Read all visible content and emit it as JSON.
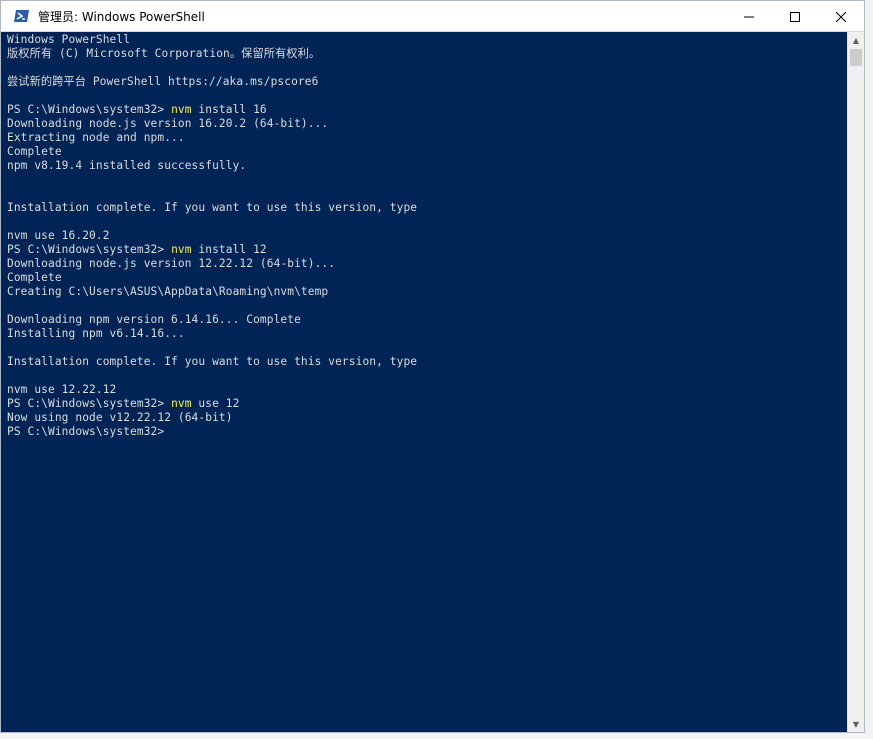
{
  "window": {
    "title": "管理员: Windows PowerShell",
    "icon": "powershell-icon"
  },
  "controls": {
    "minimize_icon": "minimize-icon",
    "maximize_icon": "maximize-icon",
    "close_icon": "close-icon"
  },
  "console": {
    "colors": {
      "background": "#012456",
      "text": "#dcdcdc",
      "command": "#f3f04a"
    },
    "lines": [
      {
        "prefix": "Windows PowerShell",
        "cmd": "",
        "rest": ""
      },
      {
        "prefix": "版权所有 (C) Microsoft Corporation。保留所有权利。",
        "cmd": "",
        "rest": ""
      },
      {
        "prefix": "",
        "cmd": "",
        "rest": ""
      },
      {
        "prefix": "尝试新的跨平台 PowerShell https://aka.ms/pscore6",
        "cmd": "",
        "rest": ""
      },
      {
        "prefix": "",
        "cmd": "",
        "rest": ""
      },
      {
        "prefix": "PS C:\\Windows\\system32> ",
        "cmd": "nvm",
        "rest": " install 16"
      },
      {
        "prefix": "Downloading node.js version 16.20.2 (64-bit)...",
        "cmd": "",
        "rest": ""
      },
      {
        "prefix": "Extracting node and npm...",
        "cmd": "",
        "rest": ""
      },
      {
        "prefix": "Complete",
        "cmd": "",
        "rest": ""
      },
      {
        "prefix": "npm v8.19.4 installed successfully.",
        "cmd": "",
        "rest": ""
      },
      {
        "prefix": "",
        "cmd": "",
        "rest": ""
      },
      {
        "prefix": "",
        "cmd": "",
        "rest": ""
      },
      {
        "prefix": "Installation complete. If you want to use this version, type",
        "cmd": "",
        "rest": ""
      },
      {
        "prefix": "",
        "cmd": "",
        "rest": ""
      },
      {
        "prefix": "nvm use 16.20.2",
        "cmd": "",
        "rest": ""
      },
      {
        "prefix": "PS C:\\Windows\\system32> ",
        "cmd": "nvm",
        "rest": " install 12"
      },
      {
        "prefix": "Downloading node.js version 12.22.12 (64-bit)...",
        "cmd": "",
        "rest": ""
      },
      {
        "prefix": "Complete",
        "cmd": "",
        "rest": ""
      },
      {
        "prefix": "Creating C:\\Users\\ASUS\\AppData\\Roaming\\nvm\\temp",
        "cmd": "",
        "rest": ""
      },
      {
        "prefix": "",
        "cmd": "",
        "rest": ""
      },
      {
        "prefix": "Downloading npm version 6.14.16... Complete",
        "cmd": "",
        "rest": ""
      },
      {
        "prefix": "Installing npm v6.14.16...",
        "cmd": "",
        "rest": ""
      },
      {
        "prefix": "",
        "cmd": "",
        "rest": ""
      },
      {
        "prefix": "Installation complete. If you want to use this version, type",
        "cmd": "",
        "rest": ""
      },
      {
        "prefix": "",
        "cmd": "",
        "rest": ""
      },
      {
        "prefix": "nvm use 12.22.12",
        "cmd": "",
        "rest": ""
      },
      {
        "prefix": "PS C:\\Windows\\system32> ",
        "cmd": "nvm",
        "rest": " use 12"
      },
      {
        "prefix": "Now using node v12.22.12 (64-bit)",
        "cmd": "",
        "rest": ""
      },
      {
        "prefix": "PS C:\\Windows\\system32>",
        "cmd": "",
        "rest": ""
      }
    ]
  },
  "scrollbar": {
    "up_arrow": "▲",
    "down_arrow": "▼"
  }
}
